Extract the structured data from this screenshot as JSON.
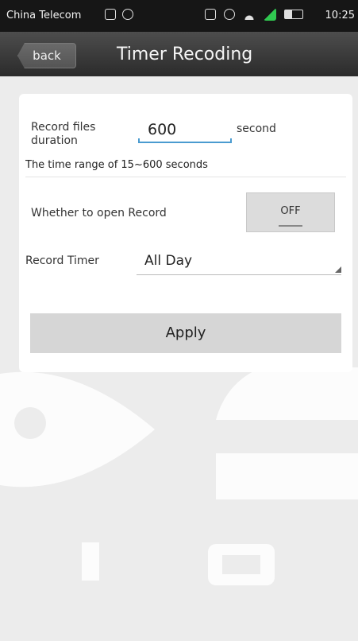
{
  "status_bar": {
    "carrier": "China Telecom",
    "time": "10:25",
    "icons": [
      "message-icon",
      "image-icon",
      "usb-icon",
      "sim-icon",
      "alarm-icon",
      "wifi-icon",
      "signal-icon",
      "battery-icon"
    ]
  },
  "header": {
    "back_label": "back",
    "title": "Timer Recoding"
  },
  "form": {
    "duration_label": "Record files duration",
    "duration_value": "600",
    "duration_unit": "second",
    "range_hint": "The time range of 15~600 seconds",
    "open_record_label": "Whether to open Record",
    "open_record_state": "OFF",
    "timer_label": "Record Timer",
    "timer_value": "All Day",
    "apply_label": "Apply"
  },
  "colors": {
    "status_bar": "#161616",
    "title_bar": "#3a3a3a",
    "background": "#ececec",
    "card": "#ffffff",
    "input_underline": "#4a9bd0",
    "button": "#d6d6d6"
  }
}
